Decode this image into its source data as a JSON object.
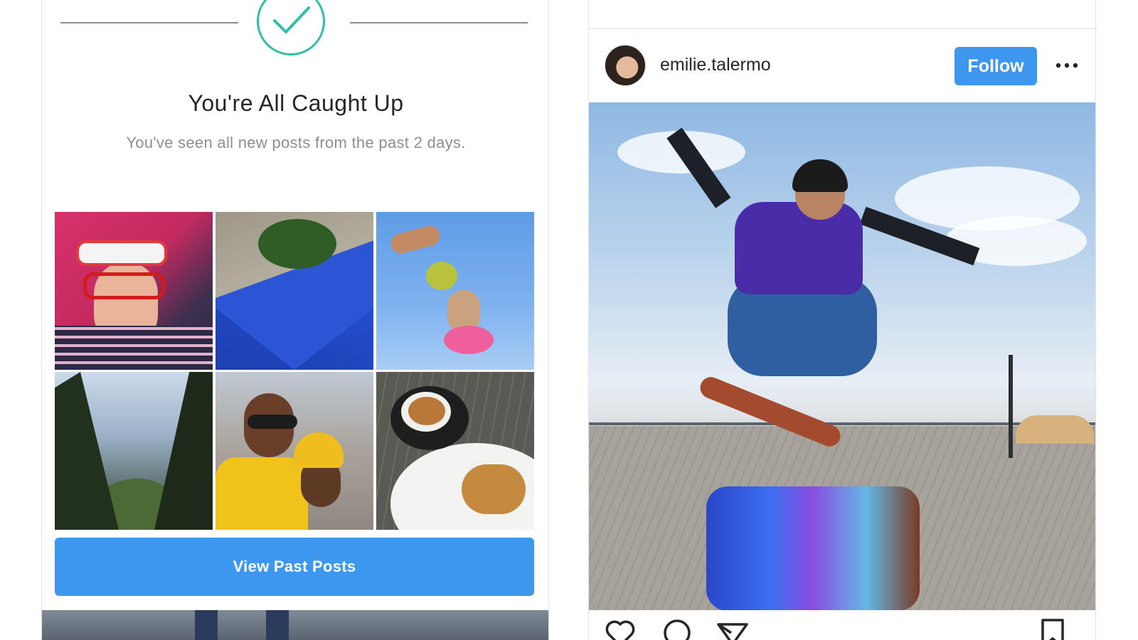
{
  "caught_up": {
    "title": "You're All Caught Up",
    "subtitle": "You've seen all new posts from the past 2 days.",
    "button_label": "View Past Posts",
    "accent_color": "#2ec0a7",
    "thumbnails": [
      "portrait-sunglasses",
      "wall-with-tree",
      "grapes-and-dog",
      "forest-trees",
      "friends-selfie",
      "coffee-and-burger"
    ]
  },
  "post": {
    "username": "emilie.talermo",
    "follow_label": "Follow",
    "image": "skateboarder-jumping-barrel",
    "actions": [
      "heart-icon",
      "comment-icon",
      "share-icon",
      "bookmark-icon"
    ],
    "button_color": "#3e97ee"
  }
}
